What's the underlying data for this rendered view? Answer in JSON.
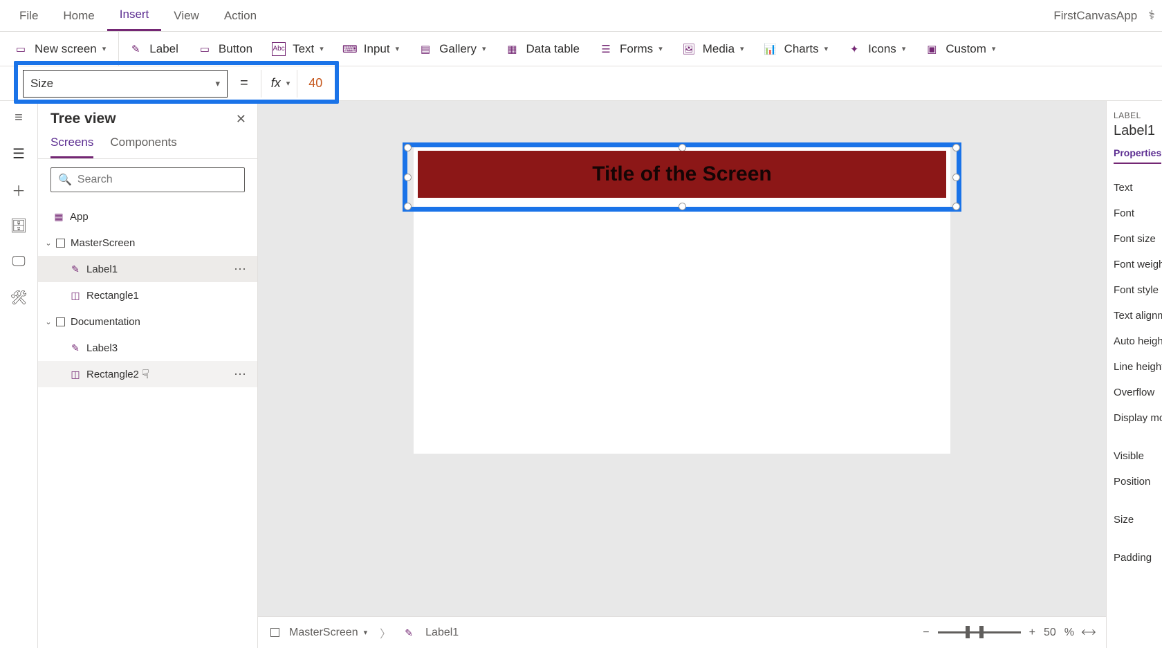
{
  "menu": {
    "file": "File",
    "home": "Home",
    "insert": "Insert",
    "view": "View",
    "action": "Action",
    "appName": "FirstCanvasApp"
  },
  "ribbon": {
    "newScreen": "New screen",
    "label": "Label",
    "button": "Button",
    "text": "Text",
    "input": "Input",
    "gallery": "Gallery",
    "dataTable": "Data table",
    "forms": "Forms",
    "media": "Media",
    "charts": "Charts",
    "icons": "Icons",
    "custom": "Custom"
  },
  "formula": {
    "property": "Size",
    "value": "40"
  },
  "tree": {
    "title": "Tree view",
    "tabs": {
      "screens": "Screens",
      "components": "Components"
    },
    "searchPlaceholder": "Search",
    "items": {
      "app": "App",
      "master": "MasterScreen",
      "label1": "Label1",
      "rect1": "Rectangle1",
      "doc": "Documentation",
      "label3": "Label3",
      "rect2": "Rectangle2"
    }
  },
  "canvas": {
    "labelText": "Title of the Screen"
  },
  "tray": {
    "screen": "MasterScreen",
    "element": "Label1",
    "zoom": "50",
    "pct": "%"
  },
  "props": {
    "type": "LABEL",
    "name": "Label1",
    "tab": "Properties",
    "rows": [
      "Text",
      "Font",
      "Font size",
      "Font weight",
      "Font style",
      "Text alignment",
      "Auto height",
      "Line height",
      "Overflow",
      "Display mode",
      "Visible",
      "Position",
      "Size",
      "Padding"
    ]
  }
}
